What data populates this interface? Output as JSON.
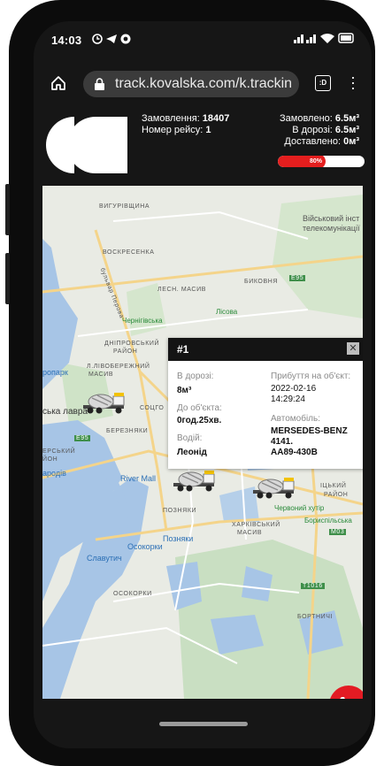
{
  "status_bar": {
    "time": "14:03"
  },
  "browser": {
    "url": "track.kovalska.com/k.trackin",
    "tab_label": ":D"
  },
  "order": {
    "order_label": "Замовлення:",
    "order_number": "18407",
    "trip_label": "Номер рейсу:",
    "trip_number": "1",
    "ordered_label": "Замовлено:",
    "ordered_value": "6.5м³",
    "en_route_label": "В дорозі:",
    "en_route_value": "6.5м³",
    "delivered_label": "Доставлено:",
    "delivered_value": "0м³",
    "progress_text": "80%",
    "progress_fraction": 0.8
  },
  "map": {
    "labels": [
      "ВИГУРІВЩИНА",
      "Військовий інст",
      "телекомунікації",
      "ВОСКРЕСЕНКА",
      "бульвар Перова",
      "ЛЕСН. МАСИВ",
      "БИКОВНЯ",
      "E95",
      "Лісова",
      "Чернігівська",
      "ДНІПРОВСЬКИЙ",
      "РАЙОН",
      "Л.ЛІВОБЕРЕЖНИЙ",
      "МАСИВ",
      "ропарк",
      "ська лавра",
      "СОЦГО",
      "E95",
      "БЕРЕЗНЯКИ",
      "ЕРСЬКИЙ",
      "ЙОН",
      "ародів",
      "River Mall",
      "ПОЗНЯКИ",
      "Червоний хутір",
      "Бориспільська",
      "ХАРКІВСЬКИЙ",
      "МАСИВ",
      "Позняки",
      "Осокорки",
      "Славутич",
      "M03",
      "ОСОКОРКИ",
      "Т1016",
      "БОРТНИЧІ",
      "ІЦЬКИЙ",
      "РАЙОН"
    ]
  },
  "popup": {
    "title": "#1",
    "status_label": "В дорозі:",
    "status_value": "8м³",
    "eta_label": "До об'єкта:",
    "eta_value": "0год.25хв.",
    "driver_label": "Водій:",
    "driver_value": "Леонід",
    "arrival_label": "Прибуття на об'єкт:",
    "arrival_date": "2022-02-16",
    "arrival_time": "14:29:24",
    "vehicle_label": "Автомобіль:",
    "vehicle_line1": "MERSEDES-BENZ",
    "vehicle_line2": "4141.",
    "vehicle_line3": "AA89-430B"
  },
  "colors": {
    "accent": "#e31b23",
    "popup_header": "#141414",
    "map_bg": "#e9ebe4",
    "water": "#a7c5e6"
  },
  "icons": [
    "home-icon",
    "lock-icon",
    "tab-icon",
    "menu-icon",
    "phone-icon",
    "truck-icon"
  ]
}
